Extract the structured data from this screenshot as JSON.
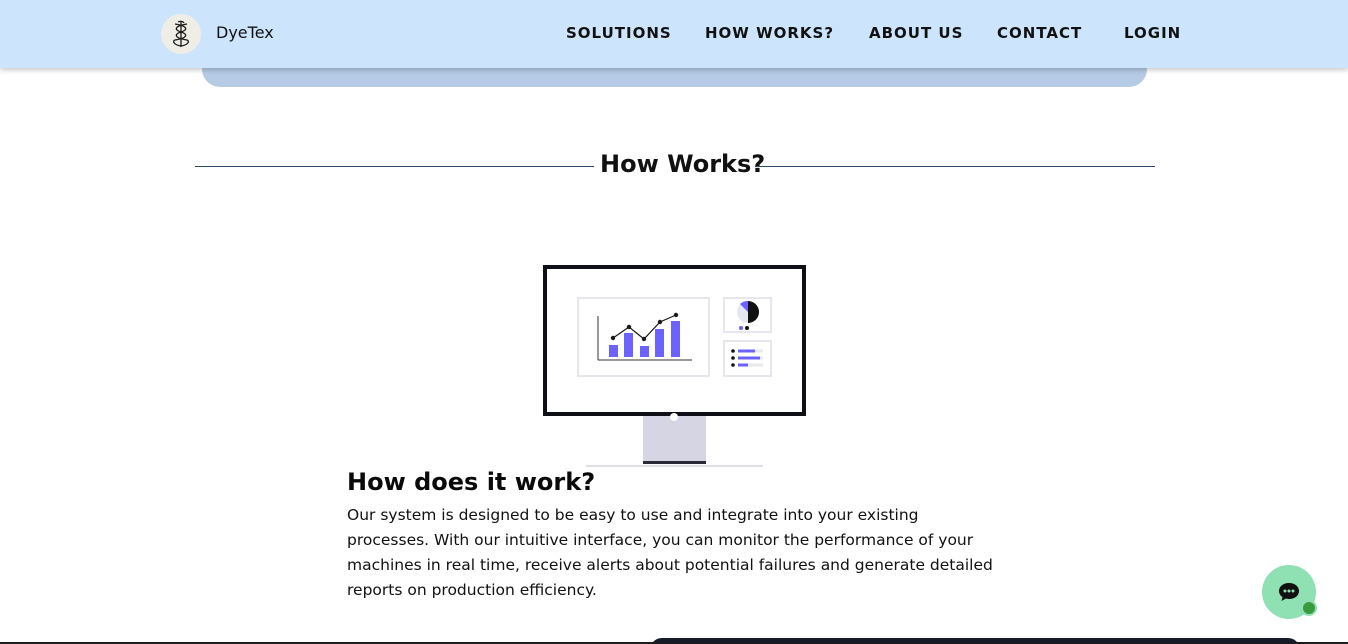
{
  "header": {
    "brand": "DyeTex",
    "nav": [
      "SOLUTIONS",
      "HOW WORKS?",
      "ABOUT US",
      "CONTACT",
      "LOGIN"
    ]
  },
  "section": {
    "title": "How Works?"
  },
  "content": {
    "heading": "How does it work?",
    "body": "Our system is designed to be easy to use and integrate into your existing processes. With our intuitive interface, you can monitor the performance of your machines in real time, receive alerts about potential failures and generate detailed reports on production efficiency."
  },
  "chat": {
    "icon": "chat-bubble-icon",
    "status_color": "#3a9b3e"
  },
  "colors": {
    "header_bg": "#cde5fc",
    "accent": "#6c63ff",
    "chat_bg": "#8fe0b3"
  }
}
